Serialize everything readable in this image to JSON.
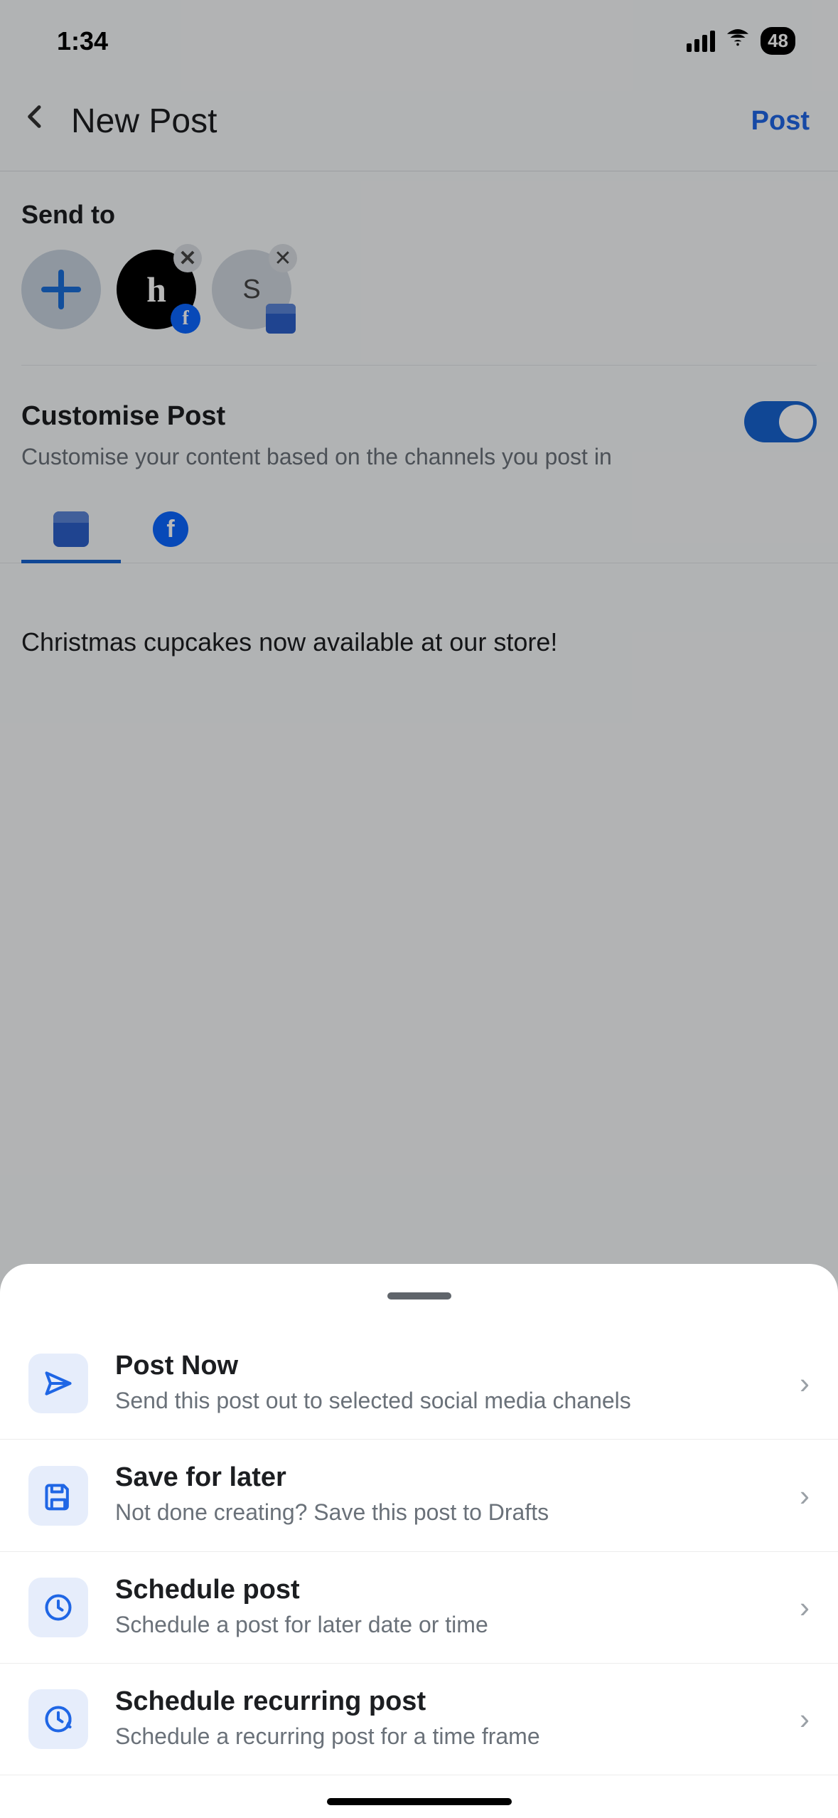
{
  "status": {
    "time": "1:34",
    "battery": "48"
  },
  "header": {
    "title": "New Post",
    "post_button": "Post"
  },
  "send_to": {
    "label": "Send to",
    "channels": [
      {
        "type": "add"
      },
      {
        "type": "account",
        "initial": "h",
        "platform": "facebook"
      },
      {
        "type": "account",
        "initial": "S",
        "platform": "shop"
      }
    ]
  },
  "customise": {
    "title": "Customise Post",
    "description": "Customise your content based on the channels you post in",
    "enabled": true
  },
  "tabs": {
    "active": "shop",
    "items": [
      "shop",
      "facebook"
    ]
  },
  "post": {
    "content": "Christmas cupcakes now available at our store!"
  },
  "sheet": {
    "options": [
      {
        "title": "Post Now",
        "description": "Send this post out to selected social media chanels",
        "icon": "send"
      },
      {
        "title": "Save for later",
        "description": "Not done creating? Save this post to Drafts",
        "icon": "save"
      },
      {
        "title": "Schedule post",
        "description": "Schedule a post for later date or time",
        "icon": "clock"
      },
      {
        "title": "Schedule recurring post",
        "description": "Schedule a recurring post for a time frame",
        "icon": "clock-refresh"
      }
    ]
  },
  "colors": {
    "accent": "#1f66e5"
  }
}
